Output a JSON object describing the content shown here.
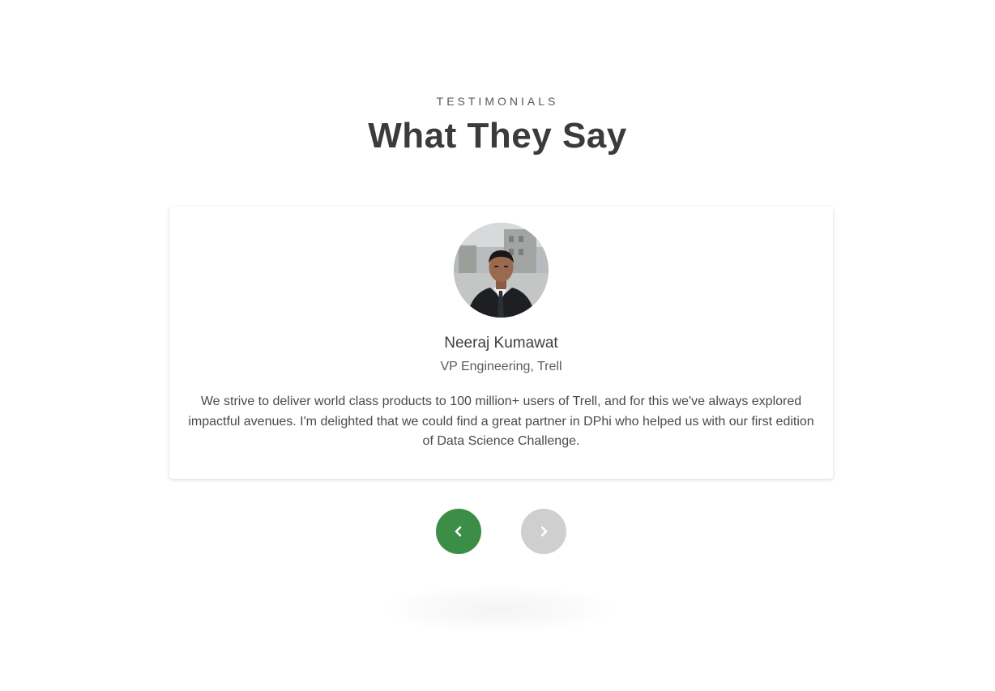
{
  "section": {
    "eyebrow": "TESTIMONIALS",
    "title": "What They Say"
  },
  "testimonial": {
    "name": "Neeraj Kumawat",
    "role": "VP Engineering, Trell",
    "quote": "We strive to deliver world class products to 100 million+ users of Trell, and for this we've always explored impactful avenues. I'm delighted that we could find a great partner in DPhi who helped us with our first edition of Data Science Challenge.",
    "avatar_icon": "person-photo"
  },
  "navigation": {
    "prev_icon": "chevron-left-icon",
    "next_icon": "chevron-right-icon"
  },
  "colors": {
    "accent": "#3c8d45",
    "disabled": "#cfcfcf",
    "heading": "#3b3b3b",
    "text": "#4a4a4a"
  }
}
